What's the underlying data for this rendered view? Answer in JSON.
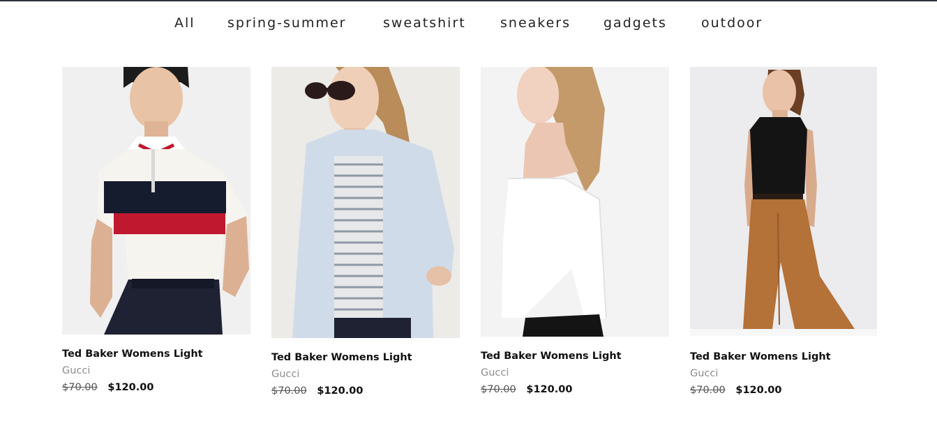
{
  "nav": {
    "tabs": [
      {
        "label": "All"
      },
      {
        "label": "spring-summer"
      },
      {
        "label": "sweatshirt"
      },
      {
        "label": "sneakers"
      },
      {
        "label": "gadgets"
      },
      {
        "label": "outdoor"
      }
    ]
  },
  "products": [
    {
      "title": "Ted Baker Womens Light",
      "brand": "Gucci",
      "old_price": "$70.00",
      "price": "$120.00"
    },
    {
      "title": "Ted Baker Womens Light",
      "brand": "Gucci",
      "old_price": "$70.00",
      "price": "$120.00"
    },
    {
      "title": "Ted Baker Womens Light",
      "brand": "Gucci",
      "old_price": "$70.00",
      "price": "$120.00"
    },
    {
      "title": "Ted Baker Womens Light",
      "brand": "Gucci",
      "old_price": "$70.00",
      "price": "$120.00"
    }
  ],
  "colors": {
    "topline": "#2b3038",
    "text": "#111111",
    "brand_text": "#8c8c8c"
  }
}
